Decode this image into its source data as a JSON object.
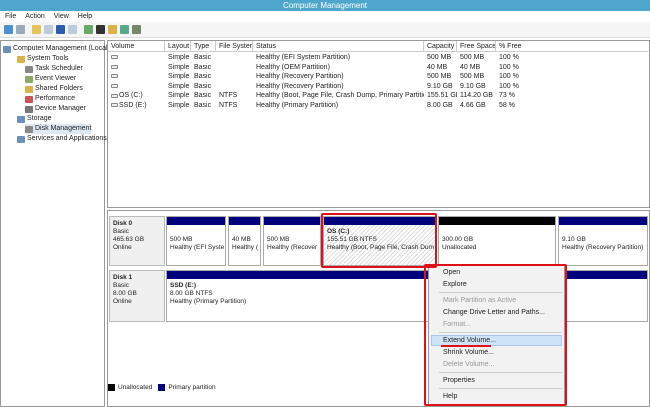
{
  "window": {
    "title": "Computer Management"
  },
  "menu": [
    "File",
    "Action",
    "View",
    "Help"
  ],
  "tree": [
    {
      "label": "Computer Management (Local",
      "level": 0,
      "color": "#6a8fb8"
    },
    {
      "label": "System Tools",
      "level": 1,
      "color": "#d9b24a"
    },
    {
      "label": "Task Scheduler",
      "level": 2,
      "color": "#888"
    },
    {
      "label": "Event Viewer",
      "level": 2,
      "color": "#8a6"
    },
    {
      "label": "Shared Folders",
      "level": 2,
      "color": "#d9b24a"
    },
    {
      "label": "Performance",
      "level": 2,
      "color": "#c55"
    },
    {
      "label": "Device Manager",
      "level": 2,
      "color": "#777"
    },
    {
      "label": "Storage",
      "level": 1,
      "color": "#6a8fb8"
    },
    {
      "label": "Disk Management",
      "level": 2,
      "color": "#888"
    },
    {
      "label": "Services and Applications",
      "level": 1,
      "color": "#6a8fb8"
    }
  ],
  "volumes": {
    "columns": [
      "Volume",
      "Layout",
      "Type",
      "File System",
      "Status",
      "Capacity",
      "Free Space",
      "% Free"
    ],
    "rows": [
      [
        "",
        "Simple",
        "Basic",
        "",
        "Healthy (EFI System Partition)",
        "500 MB",
        "500 MB",
        "100 %"
      ],
      [
        "",
        "Simple",
        "Basic",
        "",
        "Healthy (OEM Partition)",
        "40 MB",
        "40 MB",
        "100 %"
      ],
      [
        "",
        "Simple",
        "Basic",
        "",
        "Healthy (Recovery Partition)",
        "500 MB",
        "500 MB",
        "100 %"
      ],
      [
        "",
        "Simple",
        "Basic",
        "",
        "Healthy (Recovery Partition)",
        "9.10 GB",
        "9.10 GB",
        "100 %"
      ],
      [
        "OS (C:)",
        "Simple",
        "Basic",
        "NTFS",
        "Healthy (Boot, Page File, Crash Dump, Primary Partition)",
        "155.51 GB",
        "114.20 GB",
        "73 %"
      ],
      [
        "SSD (E:)",
        "Simple",
        "Basic",
        "NTFS",
        "Healthy (Primary Partition)",
        "8.00 GB",
        "4.66 GB",
        "58 %"
      ]
    ]
  },
  "disks": [
    {
      "name": "Disk 0",
      "type": "Basic",
      "size": "465.63 GB",
      "status": "Online",
      "partitions": [
        {
          "name": "",
          "size": "500 MB",
          "status": "Healthy (EFI Syste"
        },
        {
          "name": "",
          "size": "40 MB",
          "status": "Healthy ("
        },
        {
          "name": "",
          "size": "500 MB",
          "status": "Healthy (Recover"
        },
        {
          "name": "OS  (C:)",
          "size": "155.51 GB NTFS",
          "status": "Healthy (Boot, Page File, Crash Dum"
        },
        {
          "name": "",
          "size": "300.00 GB",
          "status": "Unallocated"
        },
        {
          "name": "",
          "size": "9.10 GB",
          "status": "Healthy (Recovery Partition)"
        }
      ]
    },
    {
      "name": "Disk 1",
      "type": "Basic",
      "size": "8.00 GB",
      "status": "Online",
      "partitions": [
        {
          "name": "SSD  (E:)",
          "size": "8.00 GB NTFS",
          "status": "Healthy (Primary Partition)"
        }
      ]
    }
  ],
  "context_menu": [
    {
      "label": "Open",
      "enabled": true
    },
    {
      "label": "Explore",
      "enabled": true
    },
    {
      "label": "Mark Partition as Active",
      "enabled": false
    },
    {
      "label": "Change Drive Letter and Paths...",
      "enabled": true
    },
    {
      "label": "Format...",
      "enabled": false
    },
    {
      "label": "Extend Volume...",
      "enabled": true,
      "highlighted": true
    },
    {
      "label": "Shrink Volume...",
      "enabled": true
    },
    {
      "label": "Delete Volume...",
      "enabled": false
    },
    {
      "label": "Properties",
      "enabled": true
    },
    {
      "label": "Help",
      "enabled": true
    }
  ],
  "legend": {
    "unallocated": "Unallocated",
    "primary": "Primary partition"
  },
  "colors": {
    "primary": "#00007c",
    "unallocated": "#000000",
    "highlight": "#e0101a",
    "titlebar": "#4ea6cc"
  }
}
